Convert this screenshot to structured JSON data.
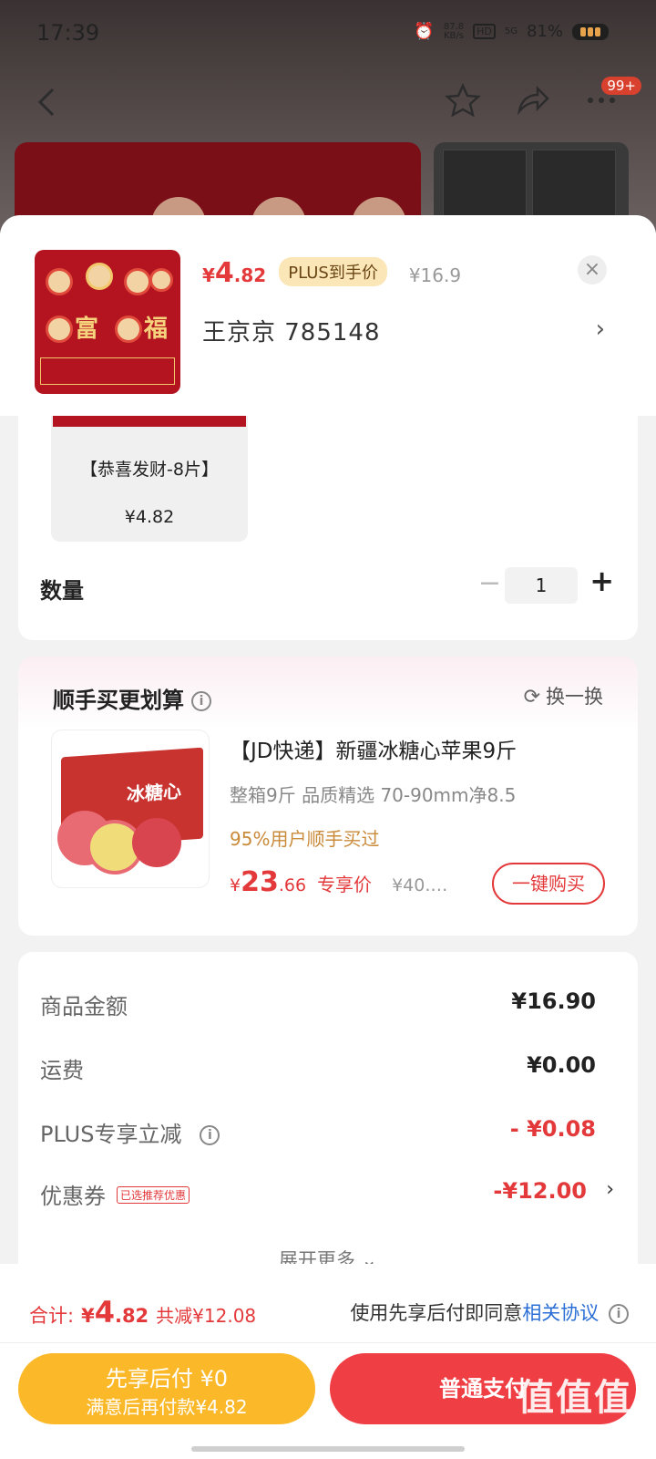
{
  "status_bar": {
    "time": "17:39",
    "net_speed_value": "87.8",
    "net_speed_unit": "KB/s",
    "hd": "HD",
    "signal": "5G",
    "battery": "81%"
  },
  "nav": {
    "badge": "99+",
    "icons": [
      "back-arrow-icon",
      "star-icon",
      "share-icon",
      "more-icon"
    ]
  },
  "sheet": {
    "price_symbol": "¥",
    "price_int": "4",
    "price_dec": ".82",
    "plus_tag": "PLUS到手价",
    "original_price": "¥16.9",
    "close": "×",
    "address": "王京京  785148",
    "address_arrow": "›"
  },
  "spec": {
    "item_label": "【恭喜发财-8片】",
    "item_price": "¥4.82",
    "qty_label": "数量",
    "qty_minus": "−",
    "qty_value": "1",
    "qty_plus": "+"
  },
  "bundle": {
    "title": "顺手买更划算",
    "swap_label": "换一换",
    "product_name": "【JD快递】新疆冰糖心苹果9斤",
    "product_sub": "整箱9斤 品质精选 70-90mm净8.5",
    "bought_hint": "95%用户顺手买过",
    "price_symbol": "¥",
    "price_int": "23",
    "price_dec": ".66",
    "price_tag": "专享价",
    "original_price": "¥40.…",
    "buy_label": "一键购买",
    "image_text": "冰糖心"
  },
  "summary": {
    "rows": [
      {
        "label": "商品金额",
        "value": "¥16.90"
      },
      {
        "label": "运费",
        "value": "¥0.00"
      },
      {
        "label": "PLUS专享立减",
        "value": "- ¥0.08"
      },
      {
        "label": "优惠券",
        "value": "-¥12.00",
        "tag": "已选推荐优惠"
      }
    ],
    "expand": "展开更多 ⌄"
  },
  "bottom": {
    "total_label": "合计:",
    "total_symbol": "¥",
    "total_int": "4",
    "total_dec": ".82",
    "total_saved": "共减¥12.08",
    "agree_text": "使用先享后付即同意",
    "agree_link": "相关协议",
    "pay_later_title": "先享后付 ¥0",
    "pay_later_sub": "满意后再付款¥4.82",
    "pay_normal": "普通支付"
  },
  "watermark": {
    "text": "值值值",
    "url": "zhizhizhi.com"
  },
  "colors": {
    "accent_red": "#e3393b",
    "pay_later_yellow": "#fbb829",
    "pay_red": "#ef3f45",
    "link_blue": "#2b6fd6"
  }
}
